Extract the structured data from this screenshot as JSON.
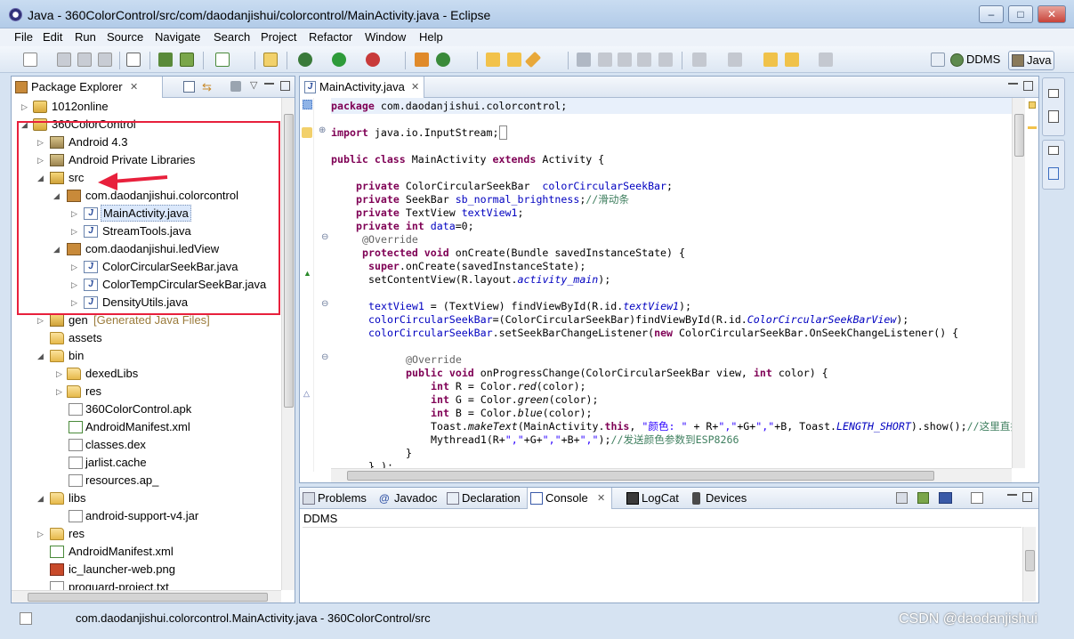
{
  "window": {
    "title": "Java - 360ColorControl/src/com/daodanjishui/colorcontrol/MainActivity.java - Eclipse",
    "minimize": "–",
    "maximize": "□",
    "close": "✕"
  },
  "menu": [
    "File",
    "Edit",
    "Run",
    "Source",
    "Navigate",
    "Search",
    "Project",
    "Refactor",
    "Window",
    "Help"
  ],
  "perspectives": {
    "ddms": "DDMS",
    "java": "Java"
  },
  "package_explorer": {
    "tab_label": "Package Explorer",
    "items": [
      {
        "label": "1012online",
        "suffix": ""
      },
      {
        "label": "360ColorControl",
        "suffix": ""
      },
      {
        "label": "Android 4.3",
        "suffix": ""
      },
      {
        "label": "Android Private Libraries",
        "suffix": ""
      },
      {
        "label": "src",
        "suffix": ""
      },
      {
        "label": "com.daodanjishui.colorcontrol",
        "suffix": ""
      },
      {
        "label": "MainActivity.java",
        "suffix": ""
      },
      {
        "label": "StreamTools.java",
        "suffix": ""
      },
      {
        "label": "com.daodanjishui.ledView",
        "suffix": ""
      },
      {
        "label": "ColorCircularSeekBar.java",
        "suffix": ""
      },
      {
        "label": "ColorTempCircularSeekBar.java",
        "suffix": ""
      },
      {
        "label": "DensityUtils.java",
        "suffix": ""
      },
      {
        "label": "gen",
        "suffix": "[Generated Java Files]"
      },
      {
        "label": "assets",
        "suffix": ""
      },
      {
        "label": "bin",
        "suffix": ""
      },
      {
        "label": "dexedLibs",
        "suffix": ""
      },
      {
        "label": "res",
        "suffix": ""
      },
      {
        "label": "360ColorControl.apk",
        "suffix": ""
      },
      {
        "label": "AndroidManifest.xml",
        "suffix": ""
      },
      {
        "label": "classes.dex",
        "suffix": ""
      },
      {
        "label": "jarlist.cache",
        "suffix": ""
      },
      {
        "label": "resources.ap_",
        "suffix": ""
      },
      {
        "label": "libs",
        "suffix": ""
      },
      {
        "label": "android-support-v4.jar",
        "suffix": ""
      },
      {
        "label": "res",
        "suffix": ""
      },
      {
        "label": "AndroidManifest.xml",
        "suffix": ""
      },
      {
        "label": "ic_launcher-web.png",
        "suffix": ""
      },
      {
        "label": "proguard-project.txt",
        "suffix": ""
      }
    ]
  },
  "editor": {
    "tab_label": "MainActivity.java",
    "code": {
      "l1_pkg_kw": "package",
      "l1_pkg_name": " com.daodanjishui.colorcontrol;",
      "l2_import_kw": "import",
      "l2_import_name": " java.io.InputStream;",
      "l3_a": "public class",
      "l3_b": " MainActivity ",
      "l3_c": "extends",
      "l3_d": " Activity {",
      "l4_kw": "private",
      "l4_type": " ColorCircularSeekBar  ",
      "l4_fld": "colorCircularSeekBar",
      "l4_end": ";",
      "l5_kw": "private",
      "l5_type": " SeekBar ",
      "l5_fld": "sb_normal_brightness",
      "l5_end": ";",
      "l5_cmt": "//滑动条",
      "l6_kw": "private",
      "l6_type": " TextView ",
      "l6_fld": "textView1",
      "l6_end": ";",
      "l7_kw": "private int",
      "l7_fld": " data",
      "l7_end": "=0;",
      "l8_ann": "@Override",
      "l9_kw": "protected void",
      "l9_rest": " onCreate(Bundle savedInstanceState) {",
      "l10_kw": "super",
      "l10_rest": ".onCreate(savedInstanceState);",
      "l11_a": "setContentView(R.layout.",
      "l11_b": "activity_main",
      "l11_c": ");",
      "l12_a": "textView1",
      "l12_b": " = (TextView) findViewById(R.id.",
      "l12_c": "textView1",
      "l12_d": ");",
      "l13_a": "colorCircularSeekBar",
      "l13_b": "=(ColorCircularSeekBar)findViewById(R.id.",
      "l13_c": "ColorCircularSeekBarView",
      "l13_d": ");",
      "l14_a": "colorCircularSeekBar",
      "l14_b": ".setSeekBarChangeListener(",
      "l14_c": "new",
      "l14_d": " ColorCircularSeekBar.OnSeekChangeListener() {",
      "l15_ann": "@Override",
      "l16_kw": "public void",
      "l16_a": " onProgressChange(ColorCircularSeekBar view, ",
      "l16_kw2": "int",
      "l16_b": " color) {",
      "l17_kw": "int",
      "l17_a": " R = Color.",
      "l17_b": "red",
      "l17_c": "(color);",
      "l18_kw": "int",
      "l18_a": " G = Color.",
      "l18_b": "green",
      "l18_c": "(color);",
      "l19_kw": "int",
      "l19_a": " B = Color.",
      "l19_b": "blue",
      "l19_c": "(color);",
      "l20_a": "Toast.",
      "l20_b": "makeText",
      "l20_c": "(MainActivity.",
      "l20_kw": "this",
      "l20_d": ", ",
      "l20_str": "\"颜色: \"",
      "l20_e": " + R+",
      "l20_str2": "\",\"",
      "l20_f": "+G+",
      "l20_str3": "\",\"",
      "l20_g": "+B, Toast.",
      "l20_h": "LENGTH_SHORT",
      "l20_i": ").show();",
      "l20_cmt": "//这里直接打",
      "l21_a": "Mythread1(R+",
      "l21_str": "\",\"",
      "l21_b": "+G+",
      "l21_str2": "\",\"",
      "l21_c": "+B+",
      "l21_str3": "\",\"",
      "l21_d": ");",
      "l21_cmt": "//发送颜色参数到ESP8266",
      "l22": "}",
      "l23": "} );"
    }
  },
  "bottom_tabs": [
    "Problems",
    "Javadoc",
    "Declaration",
    "Console",
    "LogCat",
    "Devices"
  ],
  "console": {
    "text": "DDMS"
  },
  "status": {
    "text": "com.daodanjishui.colorcontrol.MainActivity.java - 360ColorControl/src",
    "watermark": "CSDN @daodanjishui"
  },
  "colors": {
    "highlight": "#e8203c",
    "selection": "#dbe8fb",
    "keyword": "#7f0055",
    "field": "#0000c0"
  }
}
